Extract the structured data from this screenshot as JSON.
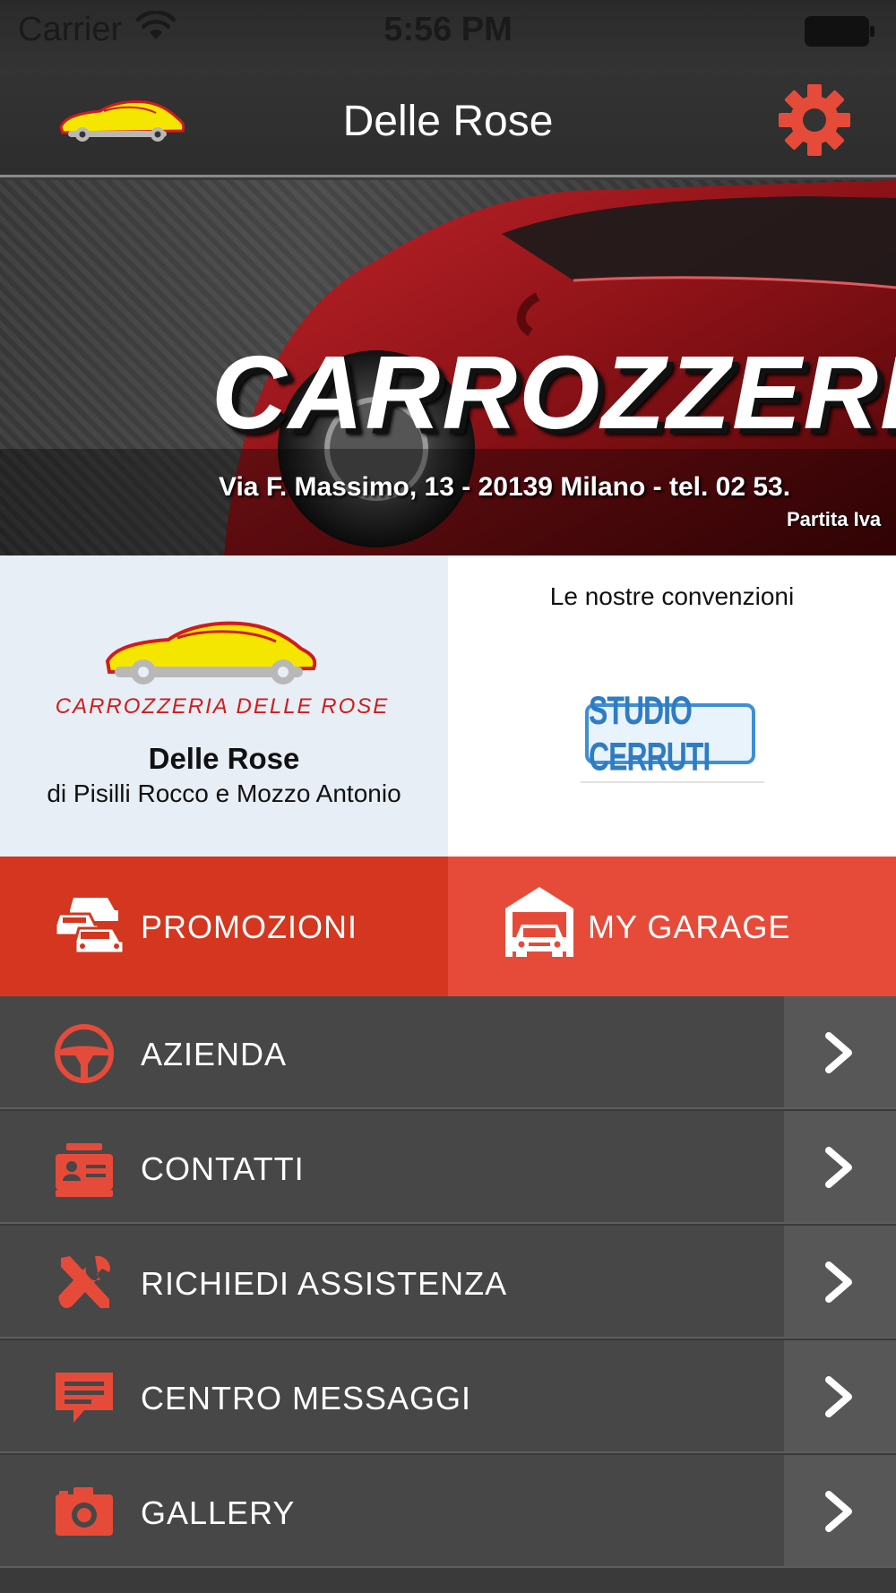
{
  "status_bar": {
    "carrier": "Carrier",
    "time": "5:56 PM"
  },
  "nav": {
    "title": "Delle Rose",
    "logo_icon": "car-logo-icon",
    "settings_icon": "gear-icon"
  },
  "banner": {
    "brand": "CARROZZERIA",
    "address": "Via F. Massimo, 13 - 20139 Milano - tel. 02 53.",
    "vat": "Partita Iva"
  },
  "company": {
    "logo_text": "CARROZZERIA DELLE ROSE",
    "name": "Delle Rose",
    "subtitle": "di Pisilli Rocco e Mozzo Antonio"
  },
  "conventions": {
    "title": "Le nostre convenzioni",
    "partner": "STUDIO CERRUTI"
  },
  "actions": {
    "promo_label": "PROMOZIONI",
    "garage_label": "MY GARAGE"
  },
  "menu": {
    "items": [
      {
        "label": "AZIENDA",
        "icon": "steering-wheel-icon"
      },
      {
        "label": "CONTATTI",
        "icon": "contact-card-icon"
      },
      {
        "label": "RICHIEDI ASSISTENZA",
        "icon": "tools-icon"
      },
      {
        "label": "CENTRO MESSAGGI",
        "icon": "message-icon"
      },
      {
        "label": "GALLERY",
        "icon": "camera-icon"
      }
    ]
  },
  "colors": {
    "accent": "#e64b3a",
    "accent_dark": "#d4361f",
    "menu_bg": "#474747",
    "menu_chevron_bg": "#575757",
    "partner_blue": "#3d8fd6"
  }
}
